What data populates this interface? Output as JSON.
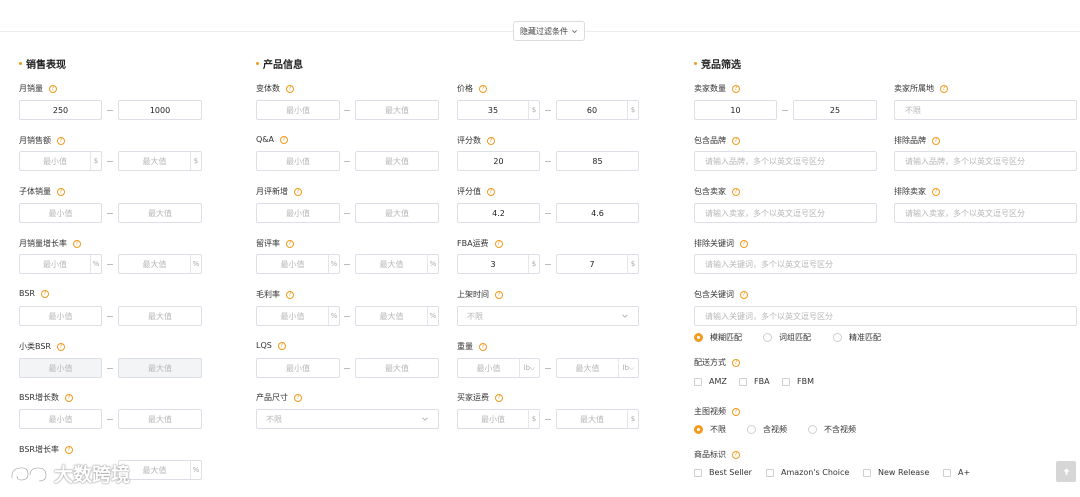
{
  "toggle_label": "隐藏过滤条件",
  "sections": {
    "sales": "销售表现",
    "product": "产品信息",
    "competitor": "竞品筛选"
  },
  "sales": {
    "monthly_sales": {
      "label": "月销量",
      "min": "250",
      "max": "1000"
    },
    "monthly_revenue": {
      "label": "月销售额",
      "min_ph": "最小值",
      "max_ph": "最大值",
      "unit": "$"
    },
    "child_sales": {
      "label": "子体销量",
      "min_ph": "最小值",
      "max_ph": "最大值"
    },
    "sales_growth": {
      "label": "月销量增长率",
      "min_ph": "最小值",
      "max_ph": "最大值",
      "unit": "%"
    },
    "bsr": {
      "label": "BSR",
      "min_ph": "最小值",
      "max_ph": "最大值"
    },
    "sub_bsr": {
      "label": "小类BSR",
      "min_ph": "最小值",
      "max_ph": "最大值"
    },
    "bsr_growth_count": {
      "label": "BSR增长数",
      "min_ph": "最小值",
      "max_ph": "最大值"
    },
    "bsr_growth_rate": {
      "label": "BSR增长率",
      "max_ph": "最大值",
      "unit": "%"
    }
  },
  "product": {
    "variants": {
      "label": "变体数",
      "min_ph": "最小值",
      "max_ph": "最大值"
    },
    "qa": {
      "label": "Q&A",
      "min_ph": "最小值",
      "max_ph": "最大值"
    },
    "monthly_new_reviews": {
      "label": "月评新增",
      "min_ph": "最小值",
      "max_ph": "最大值"
    },
    "review_rate": {
      "label": "留评率",
      "min_ph": "最小值",
      "max_ph": "最大值",
      "unit": "%"
    },
    "margin": {
      "label": "毛利率",
      "min_ph": "最小值",
      "max_ph": "最大值",
      "unit": "%"
    },
    "lqs": {
      "label": "LQS",
      "min_ph": "最小值",
      "max_ph": "最大值"
    },
    "size": {
      "label": "产品尺寸",
      "value": "不限"
    },
    "price": {
      "label": "价格",
      "min": "35",
      "max": "60",
      "unit": "$"
    },
    "review_count": {
      "label": "评分数",
      "min": "20",
      "max": "85"
    },
    "rating": {
      "label": "评分值",
      "min": "4.2",
      "max": "4.6"
    },
    "fba_fee": {
      "label": "FBA运费",
      "min": "3",
      "max": "7",
      "unit": "$"
    },
    "listing_time": {
      "label": "上架时间",
      "value": "不限"
    },
    "weight": {
      "label": "重量",
      "min_ph": "最小值",
      "max_ph": "最大值",
      "unit": "lb"
    },
    "seller_shipping": {
      "label": "买家运费",
      "min_ph": "最小值",
      "max_ph": "最大值",
      "unit": "$"
    }
  },
  "competitor": {
    "seller_count": {
      "label": "卖家数量",
      "min": "10",
      "max": "25"
    },
    "seller_location": {
      "label": "卖家所属地",
      "value": "不限"
    },
    "include_brand": {
      "label": "包含品牌",
      "placeholder": "请输入品牌，多个以英文逗号区分"
    },
    "exclude_brand": {
      "label": "排除品牌",
      "placeholder": "请输入品牌，多个以英文逗号区分"
    },
    "include_seller": {
      "label": "包含卖家",
      "placeholder": "请输入卖家，多个以英文逗号区分"
    },
    "exclude_seller": {
      "label": "排除卖家",
      "placeholder": "请输入卖家，多个以英文逗号区分"
    },
    "exclude_keywords": {
      "label": "排除关键词",
      "placeholder": "请输入关键词，多个以英文逗号区分"
    },
    "include_keywords": {
      "label": "包含关键词",
      "placeholder": "请输入关键词，多个以英文逗号区分"
    },
    "match_options": [
      "模糊匹配",
      "词组匹配",
      "精准匹配"
    ],
    "shipping": {
      "label": "配送方式",
      "options": [
        "AMZ",
        "FBA",
        "FBM"
      ]
    },
    "video": {
      "label": "主图视频",
      "options": [
        "不限",
        "含视频",
        "不含视频"
      ]
    },
    "badges": {
      "label": "商品标识",
      "options": [
        "Best Seller",
        "Amazon's Choice",
        "New Release",
        "A+"
      ]
    }
  },
  "watermark": "大数跨境",
  "accent_color": "#f39b1e"
}
